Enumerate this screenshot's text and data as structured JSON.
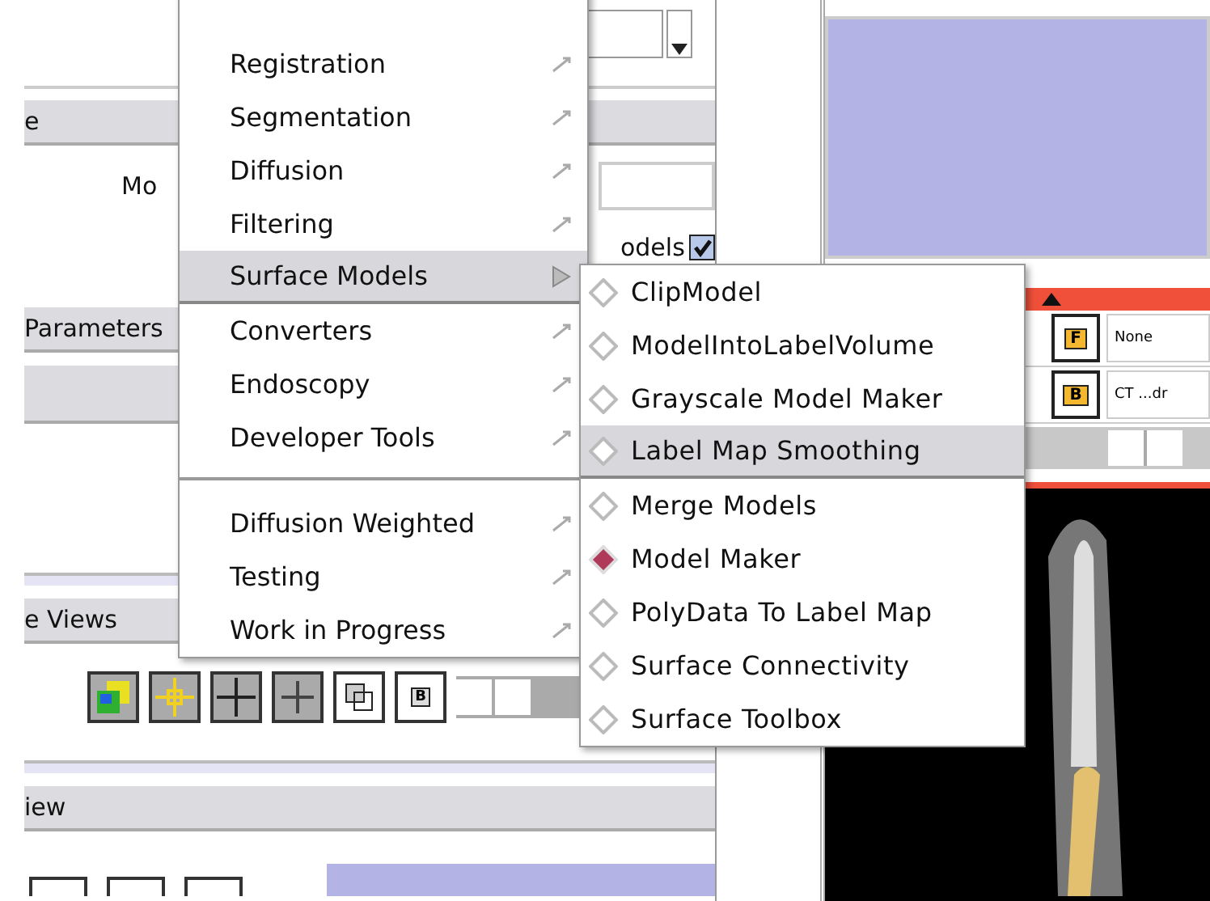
{
  "left_panel": {
    "header_top": "e",
    "field_label": "Mo",
    "models_checkbox": {
      "label": "odels",
      "checked": true
    },
    "header_parameters": "Parameters",
    "header_views": "e Views",
    "toolbar_badge": "B",
    "view_slider": {
      "level": 0
    },
    "header_bottom": "iew"
  },
  "slice_viewer": {
    "foreground": {
      "badge": "F",
      "value": "None"
    },
    "background": {
      "badge": "B",
      "value": "CT ...dr"
    },
    "slice_slider": {
      "level": 0.75
    }
  },
  "menu": {
    "items": [
      {
        "kind": "item",
        "label": "Registration",
        "selected": false
      },
      {
        "kind": "item",
        "label": "Segmentation",
        "selected": false
      },
      {
        "kind": "item",
        "label": "Diffusion",
        "selected": false
      },
      {
        "kind": "item",
        "label": "Filtering",
        "selected": false
      },
      {
        "kind": "item",
        "label": "Surface Models",
        "selected": true
      },
      {
        "kind": "item",
        "label": "Converters",
        "selected": false
      },
      {
        "kind": "item",
        "label": "Endoscopy",
        "selected": false
      },
      {
        "kind": "item",
        "label": "Developer Tools",
        "selected": false
      },
      {
        "kind": "separator"
      },
      {
        "kind": "item",
        "label": "Diffusion Weighted",
        "selected": false
      },
      {
        "kind": "item",
        "label": "Testing",
        "selected": false
      },
      {
        "kind": "item",
        "label": "Work in Progress",
        "selected": false
      }
    ]
  },
  "submenu": {
    "items": [
      {
        "label": "ClipModel",
        "selected": false,
        "checked": false
      },
      {
        "label": "ModelIntoLabelVolume",
        "selected": false,
        "checked": false
      },
      {
        "label": "Grayscale Model Maker",
        "selected": false,
        "checked": false
      },
      {
        "label": "Label Map Smoothing",
        "selected": true,
        "checked": false
      },
      {
        "label": "Merge Models",
        "selected": false,
        "checked": false
      },
      {
        "label": "Model Maker",
        "selected": false,
        "checked": true
      },
      {
        "label": "PolyData To Label Map",
        "selected": false,
        "checked": false
      },
      {
        "label": "Surface Connectivity",
        "selected": false,
        "checked": false
      },
      {
        "label": "Surface Toolbox",
        "selected": false,
        "checked": false
      }
    ]
  }
}
